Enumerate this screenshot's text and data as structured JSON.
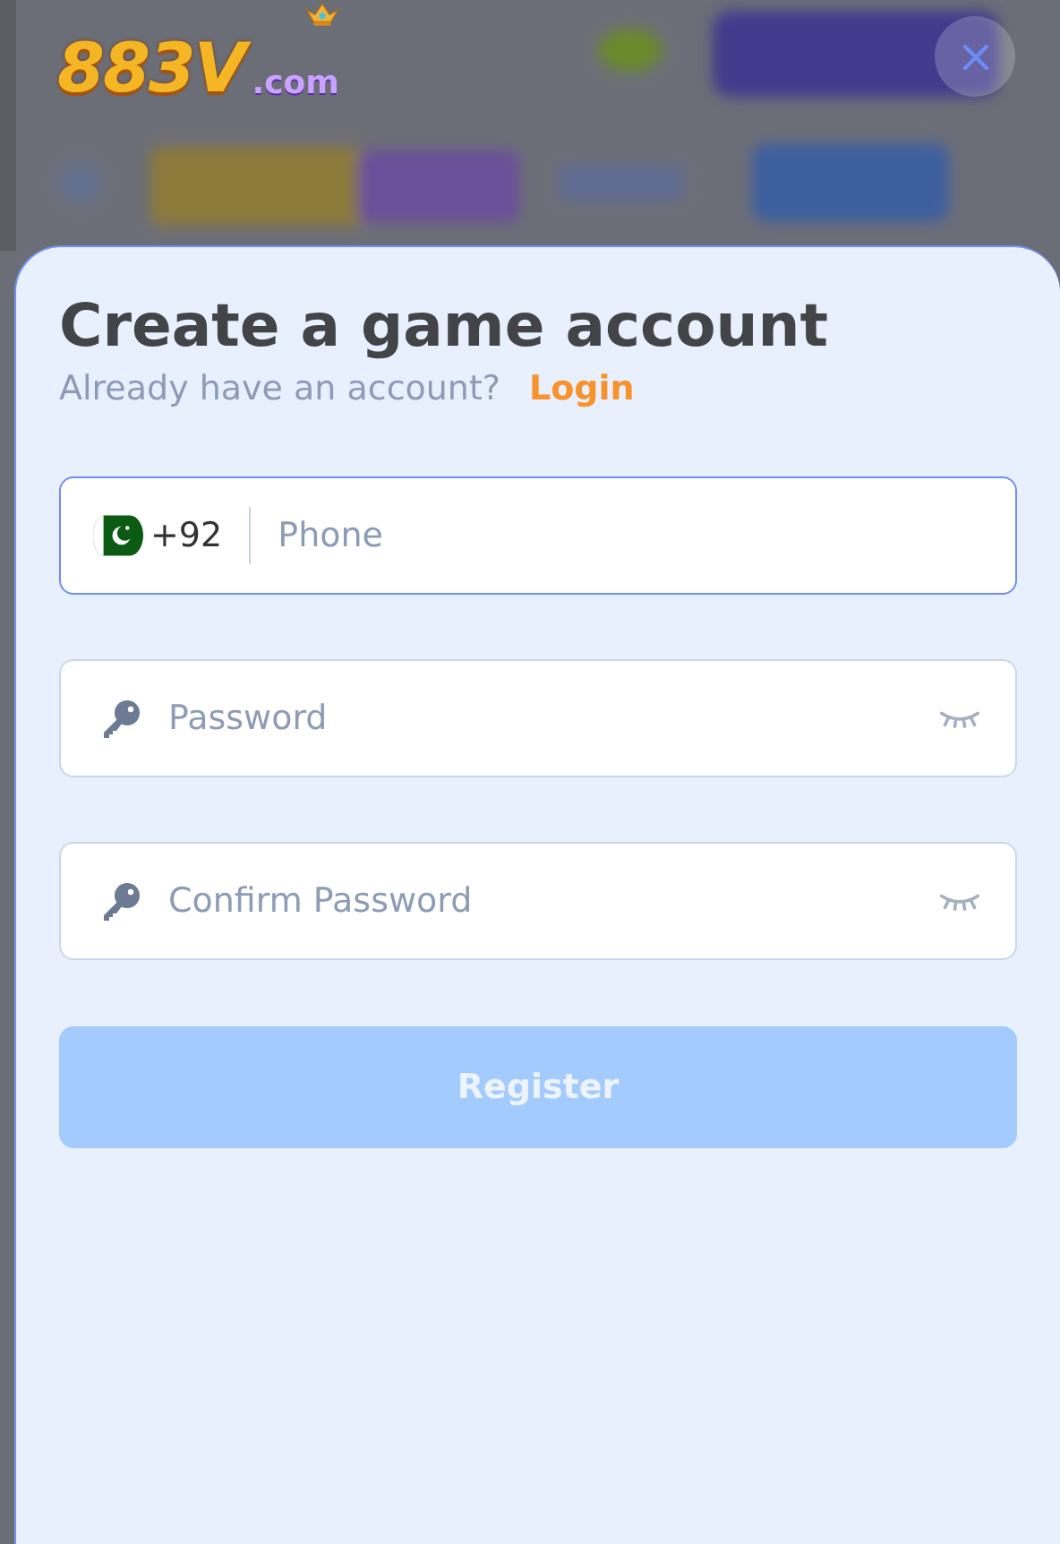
{
  "header": {
    "logo": {
      "main": "883V",
      "suffix": ".com"
    }
  },
  "sheet": {
    "title": "Create a game account",
    "subtitle": "Already have an account?",
    "login_link": "Login"
  },
  "fields": [
    {
      "kind": "phone",
      "code": "+92",
      "placeholder": "Phone",
      "focused": true
    },
    {
      "kind": "password",
      "placeholder": "Password",
      "focused": false
    },
    {
      "kind": "password",
      "placeholder": "Confirm Password",
      "focused": false
    }
  ],
  "submit": {
    "label": "Register",
    "disabled": true
  }
}
